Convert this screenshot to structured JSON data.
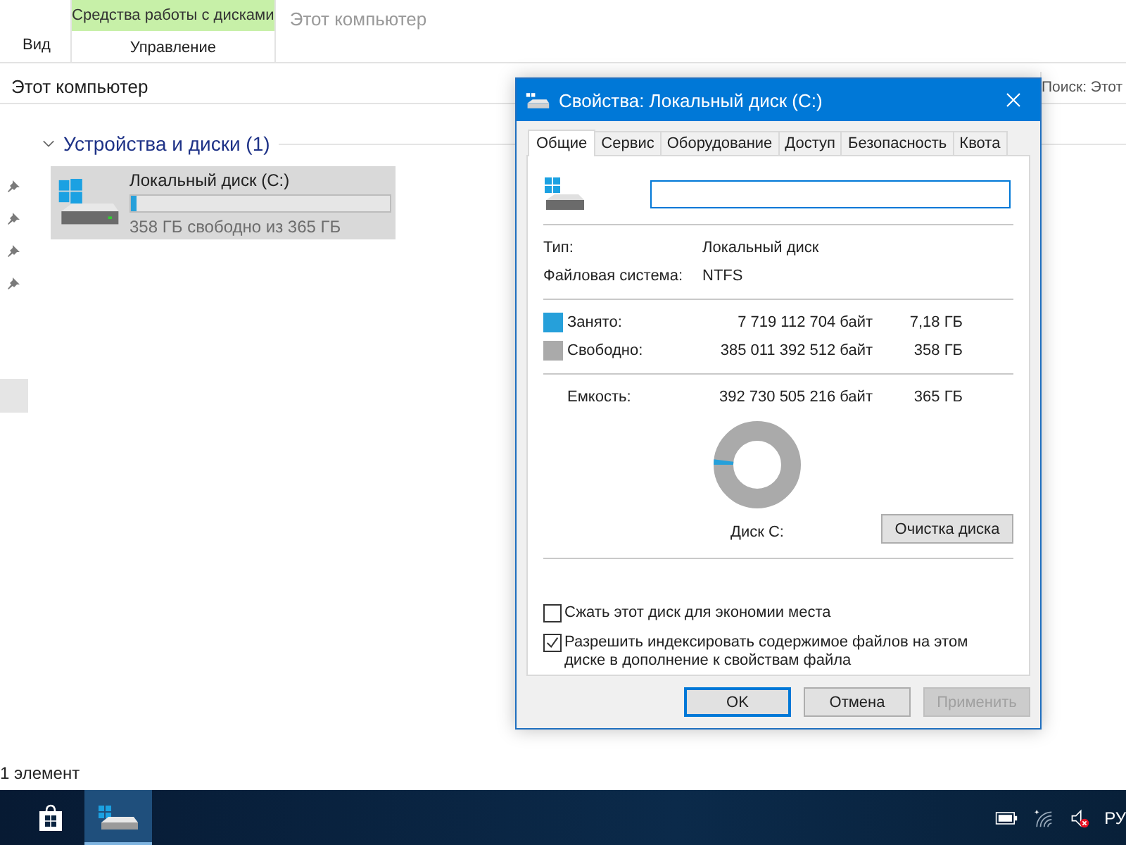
{
  "ribbon": {
    "tabs": [
      "Вид"
    ],
    "context_group": {
      "title": "Средства работы с дисками",
      "tabs": [
        "Управление"
      ]
    },
    "window_title": "Этот компьютер"
  },
  "address_bar": {
    "path": "Этот компьютер"
  },
  "search": {
    "placeholder": "Поиск: Этот"
  },
  "group": {
    "title": "Устройства и диски (1)",
    "expanded": true
  },
  "drives": [
    {
      "name": "Локальный диск (C:)",
      "level": 0.02,
      "free_text": "358 ГБ свободно из 365 ГБ",
      "selected": true
    }
  ],
  "status_bar": {
    "count": "1 элемент"
  },
  "dialog": {
    "title": "Свойства: Локальный диск (C:)",
    "tabs": [
      {
        "label": "Общие",
        "selected": true
      },
      {
        "label": "Сервис",
        "selected": false
      },
      {
        "label": "Оборудование",
        "selected": false
      },
      {
        "label": "Доступ",
        "selected": false
      },
      {
        "label": "Безопасность",
        "selected": false
      },
      {
        "label": "Квота",
        "selected": false
      }
    ],
    "info": [
      {
        "label": "Тип:",
        "value": "Локальный диск"
      },
      {
        "label": "Файловая система:",
        "value": "NTFS"
      }
    ],
    "usage": [
      {
        "label": "Занято:",
        "bytes": "7 719 112 704 байт",
        "size": "7,18 ГБ",
        "color": "#26a0da"
      },
      {
        "label": "Свободно:",
        "bytes": "385 011 392 512 байт",
        "size": "358 ГБ",
        "color": "#aaaaaa"
      }
    ],
    "capacity": {
      "label": "Емкость:",
      "bytes": "392 730 505 216 байт",
      "size": "365 ГБ"
    },
    "usage_ring": {
      "level": 0.02
    },
    "drive_label": "Диск C:",
    "cleanup_button": "Очистка диска",
    "checkboxes": [
      {
        "label": "Сжать этот диск для экономии места",
        "checked": false
      },
      {
        "label": "Разрешить индексировать содержимое файлов на этом диске в дополнение к свойствам файла",
        "checked": true
      }
    ],
    "buttons": [
      {
        "label": "OK",
        "default": true,
        "disabled": false
      },
      {
        "label": "Отмена",
        "default": false,
        "disabled": false
      },
      {
        "label": "Применить",
        "default": false,
        "disabled": true
      }
    ]
  },
  "taskbar": {
    "apps": [
      {
        "kind": "store",
        "active": false
      },
      {
        "kind": "drive",
        "active": true
      }
    ],
    "language": "РУ"
  }
}
